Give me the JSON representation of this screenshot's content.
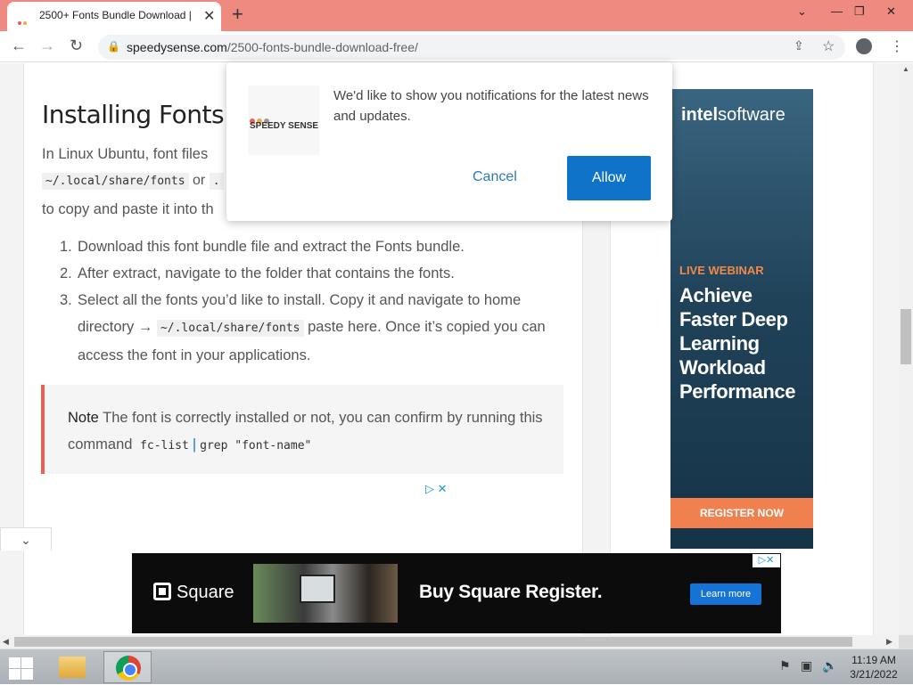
{
  "browser": {
    "tab_title": "2500+ Fonts Bundle Download |",
    "tab_close": "✕",
    "new_tab": "+",
    "url_domain": "speedysense.com",
    "url_path": "/2500-fonts-bundle-download-free/",
    "window_controls": {
      "minimize": "—",
      "restore": "❐",
      "close": "✕",
      "tab_list": "⌄"
    }
  },
  "article": {
    "heading": "Installing Fonts in",
    "para1": "In Linux Ubuntu, font files",
    "path_code": "~/.local/share/fonts",
    "or_text": "or",
    "para1_tail": "to copy and paste it into th",
    "steps": [
      {
        "num": "1.",
        "text": "Download this font bundle file and extract the Fonts bundle."
      },
      {
        "num": "2.",
        "text": "After extract, navigate to the folder that contains the fonts."
      },
      {
        "num": "3.",
        "text_a": "Select all the fonts you’d like to install. Copy it and navigate to home directory →",
        "code": "~/.local/share/fonts",
        "text_b": "paste here. Once it’s copied you can access the font in your applications."
      }
    ],
    "note_label": "Note",
    "note_text": "The font is correctly installed or not, you can confirm by running this command",
    "note_code_a": "fc-list",
    "note_pipe": "|",
    "note_code_b": "grep \"font-name\"",
    "ad_choices": "▷ ✕"
  },
  "notification": {
    "logo_text": "SPEEDY SENSE",
    "message": "We'd like to show you notifications for the latest news and updates.",
    "cancel_label": "Cancel",
    "allow_label": "Allow"
  },
  "intel_ad": {
    "brand_bold": "intel",
    "brand_rest": "software",
    "tag": "LIVE WEBINAR",
    "headline": "Achieve Faster Deep Learning Workload Performance",
    "cta": "REGISTER NOW"
  },
  "square_ad": {
    "logo": "Square",
    "headline": "Buy Square Register.",
    "cta": "Learn more",
    "adchoices": "▷✕"
  },
  "taskbar": {
    "time": "11:19 AM",
    "date": "3/21/2022"
  },
  "colors": {
    "tabbar": "#ee8a80",
    "accent": "#0f74c9",
    "note_border": "#e5615a"
  }
}
